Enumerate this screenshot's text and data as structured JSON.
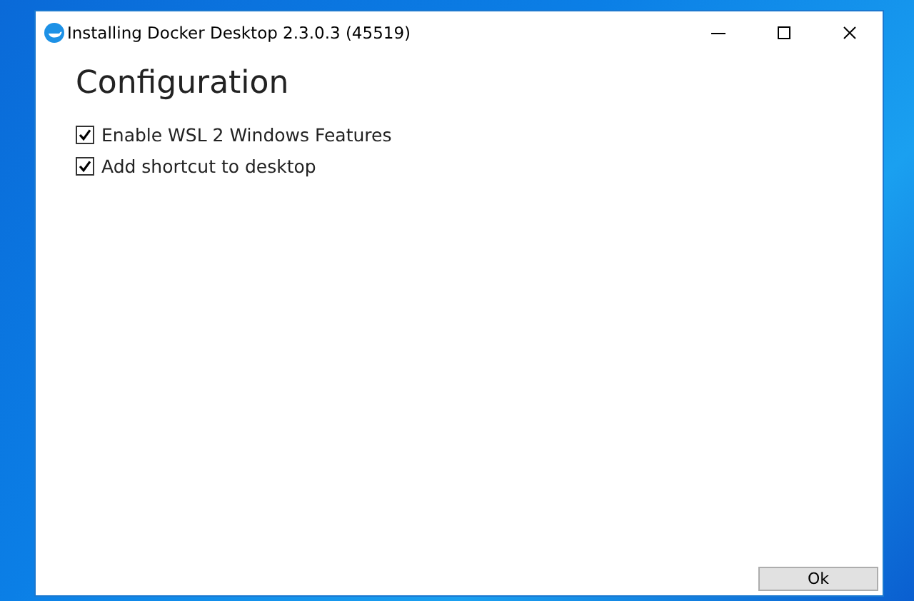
{
  "window": {
    "title": "Installing Docker Desktop 2.3.0.3 (45519)"
  },
  "heading": "Configuration",
  "options": [
    {
      "label": "Enable WSL 2 Windows Features",
      "checked": true
    },
    {
      "label": "Add shortcut to desktop",
      "checked": true
    }
  ],
  "buttons": [
    "Ok"
  ]
}
